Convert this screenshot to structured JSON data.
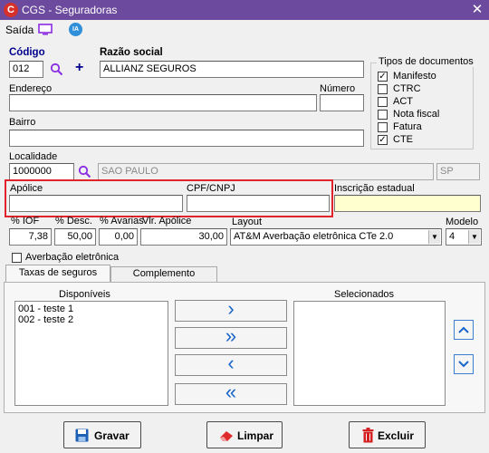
{
  "window": {
    "title": "CGS - Seguradoras",
    "close": "✕",
    "logo": "C"
  },
  "menu": {
    "saida": "Saída",
    "ia": "IA"
  },
  "form": {
    "codigo_label": "Código",
    "codigo_value": "012",
    "razao_label": "Razão social",
    "razao_value": "ALLIANZ SEGUROS",
    "endereco_label": "Endereço",
    "endereco_value": "",
    "numero_label": "Número",
    "numero_value": "",
    "bairro_label": "Bairro",
    "bairro_value": "",
    "localidade_label": "Localidade",
    "localidade_code": "1000000",
    "localidade_city": "SAO PAULO",
    "localidade_uf": "SP",
    "apolice_label": "Apólice",
    "apolice_value": "",
    "cpf_label": "CPF/CNPJ",
    "cpf_value": "",
    "inscricao_label": "Inscrição estadual",
    "inscricao_value": "",
    "iof_label": "% IOF",
    "iof_value": "7,38",
    "desc_label": "% Desc.",
    "desc_value": "50,00",
    "avarias_label": "% Avarias",
    "avarias_value": "0,00",
    "vlr_apolice_label": "Vlr. Apólice",
    "vlr_apolice_value": "30,00",
    "layout_label": "Layout",
    "layout_value": "AT&M Averbação eletrônica CTe 2.0",
    "modelo_label": "Modelo",
    "modelo_value": "4",
    "averbacao_label": "Averbação eletrônica"
  },
  "tipos_documentos": {
    "title": "Tipos de documentos",
    "items": [
      {
        "label": "Manifesto",
        "checked": true
      },
      {
        "label": "CTRC",
        "checked": false
      },
      {
        "label": "ACT",
        "checked": false
      },
      {
        "label": "Nota fiscal",
        "checked": false
      },
      {
        "label": "Fatura",
        "checked": false
      },
      {
        "label": "CTE",
        "checked": true
      }
    ]
  },
  "tabs": [
    {
      "label": "Taxas de seguros"
    },
    {
      "label": "Complemento"
    }
  ],
  "transfer": {
    "disponiveis_label": "Disponíveis",
    "selecionados_label": "Selecionados",
    "disponiveis": [
      "001 - teste 1",
      "002 - teste 2"
    ],
    "selecionados": []
  },
  "buttons": {
    "gravar": "Gravar",
    "limpar": "Limpar",
    "excluir": "Excluir"
  },
  "colors": {
    "title_bar": "#6c4a9e",
    "accent_blue": "#1664c8",
    "highlight_red": "#e0242a",
    "required_yellow": "#ffffd0"
  }
}
